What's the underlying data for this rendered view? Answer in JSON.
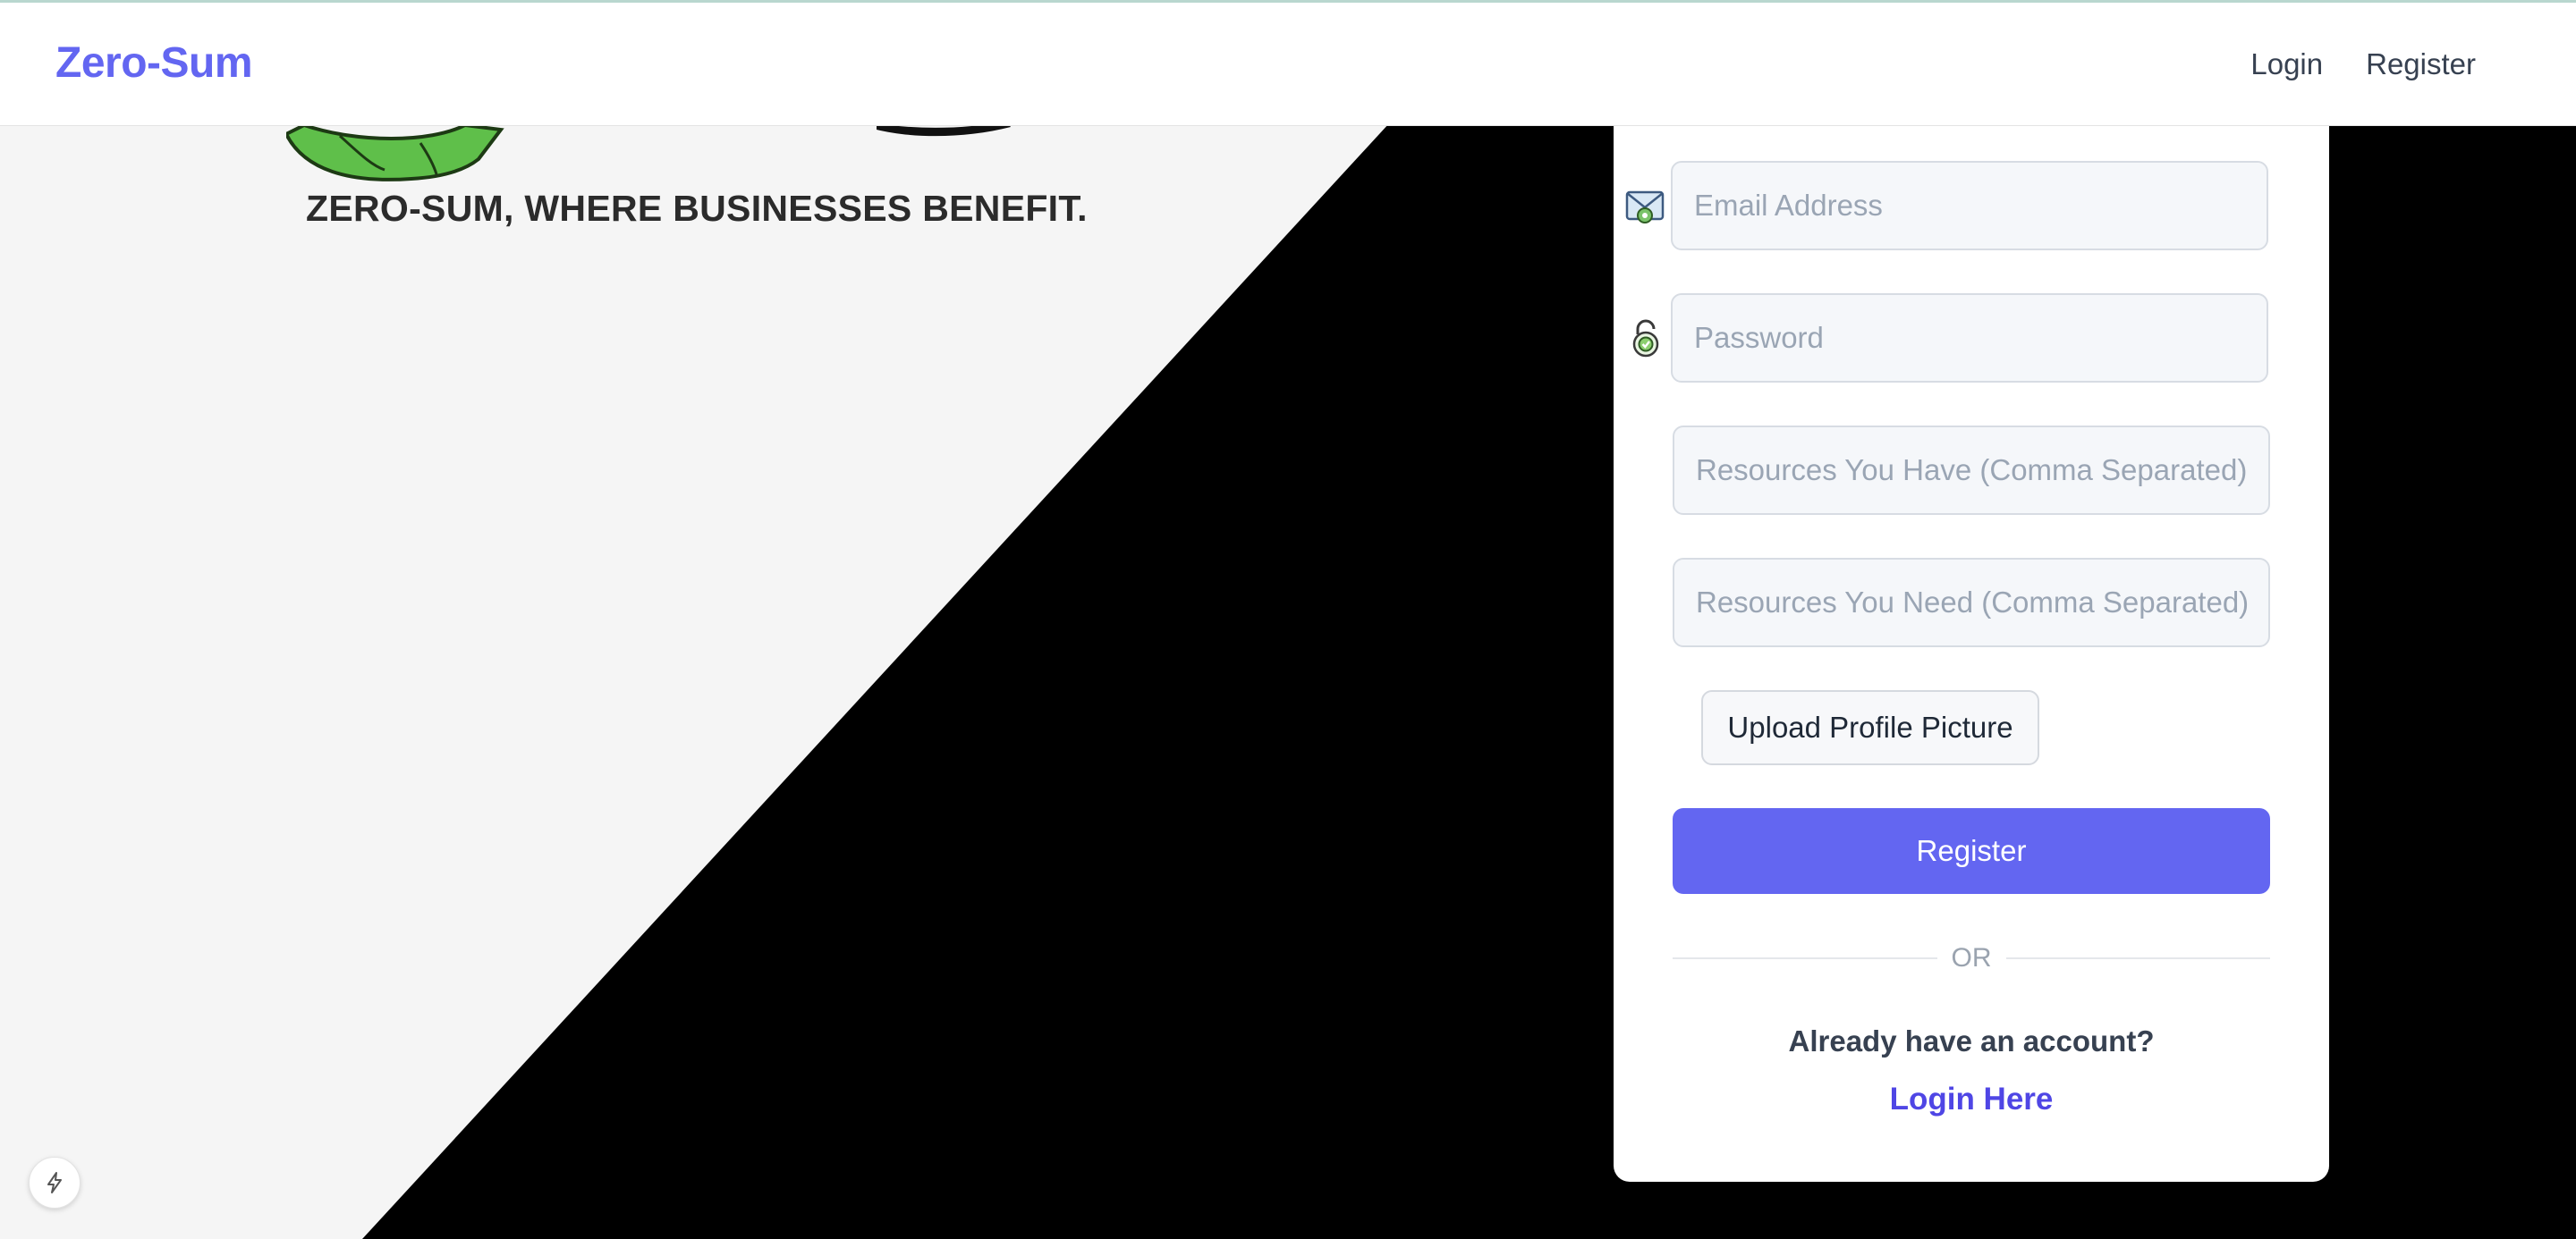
{
  "nav": {
    "brand": "Zero-Sum",
    "links": [
      "Login",
      "Register"
    ]
  },
  "hero": {
    "tagline": "ZERO-SUM, WHERE BUSINESSES BENEFIT."
  },
  "form": {
    "email_placeholder": "Email Address",
    "password_placeholder": "Password",
    "resources_have_placeholder": "Resources You Have (Comma Separated)",
    "resources_need_placeholder": "Resources You Need (Comma Separated)",
    "upload_label": "Upload Profile Picture",
    "submit_label": "Register",
    "divider_text": "OR",
    "already_text": "Already have an account?",
    "login_link": "Login Here"
  },
  "icons": {
    "email": "envelope-icon",
    "password": "padlock-icon",
    "dev_badge": "lightning-icon"
  },
  "colors": {
    "brand": "#6366f1",
    "link": "#4f46e5",
    "left_background": "#f5f5f5",
    "right_background": "#000000"
  }
}
